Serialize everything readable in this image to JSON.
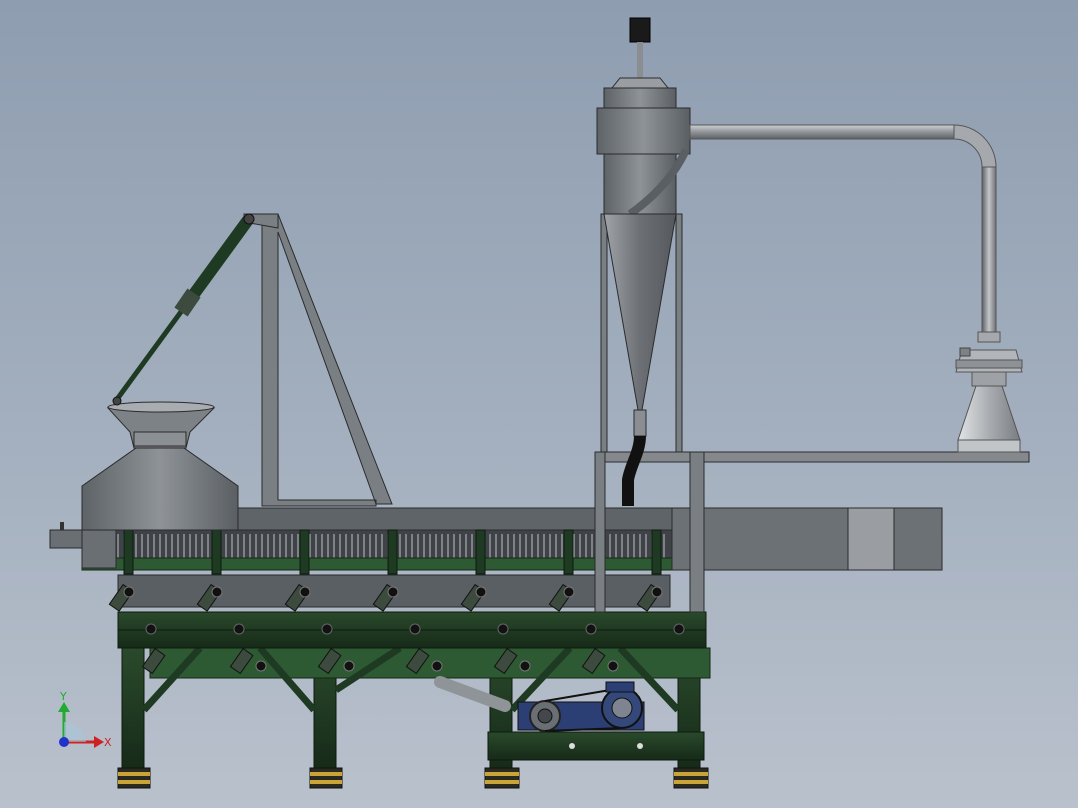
{
  "viewport": {
    "background_top": "#8e9db0",
    "background_bottom": "#b9c1cc"
  },
  "colors": {
    "steel_grey": "#8a8e93",
    "sheet_metal": "#6f7479",
    "frame_dark_green": "#1f3a22",
    "conveyor_green": "#2e5a33",
    "motor_blue": "#2b3f74",
    "foot_yellow": "#c9a438",
    "outline": "#2b2b2b",
    "axis_x": "#cc2222",
    "axis_y": "#22aa33",
    "axis_z": "#2233cc"
  },
  "model": {
    "components": [
      "feed-hopper",
      "hydraulic-cylinder",
      "a-frame-support",
      "drying-chamber",
      "cyclone-separator",
      "exhaust-duct",
      "centrifugal-fan",
      "support-frame",
      "drive-motor",
      "leveling-feet"
    ]
  },
  "triad": {
    "x_label": "X",
    "y_label": "Y"
  }
}
